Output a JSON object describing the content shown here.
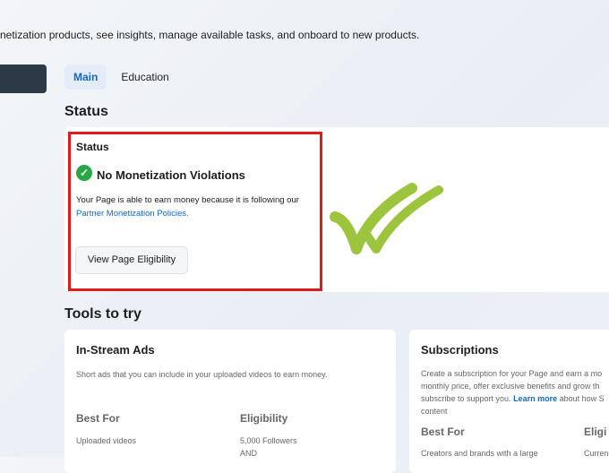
{
  "header": {
    "subtitle": "netization products, see insights, manage available tasks, and onboard to new products."
  },
  "tabs": [
    {
      "label": "Main",
      "active": true
    },
    {
      "label": "Education",
      "active": false
    }
  ],
  "status_section": {
    "heading": "Status",
    "card": {
      "label": "Status",
      "check_icon": "green-check-circle",
      "title": "No Monetization Violations",
      "description": "Your Page is able to earn money because it is following our",
      "link": "Partner Monetization Policies.",
      "button": "View Page Eligibility"
    }
  },
  "tools_section": {
    "heading": "Tools to try",
    "cards": [
      {
        "title": "In-Stream Ads",
        "description": "Short ads that you can include in your uploaded videos to earn money.",
        "best_for_label": "Best For",
        "best_for_value": "Uploaded videos",
        "eligibility_label": "Eligibility",
        "eligibility_line1": "5,000 Followers",
        "eligibility_line2": "AND"
      },
      {
        "title": "Subscriptions",
        "description_line1": "Create a subscription for your Page and earn a mo",
        "description_line2": "monthly price, offer exclusive benefits and grow th",
        "description_line3_pre": "subscribe to support you. ",
        "description_link": "Learn more",
        "description_line3_post": " about how S",
        "description_line4": "content",
        "best_for_label": "Best For",
        "best_for_value": "Creators and brands with a large",
        "eligibility_label": "Eligi",
        "eligibility_value": "Curren"
      }
    ]
  },
  "colors": {
    "accent": "#1467c6",
    "highlight_box": "#e11a1a",
    "check_green": "#2aa745",
    "annotation_check": "#9cc43c"
  }
}
